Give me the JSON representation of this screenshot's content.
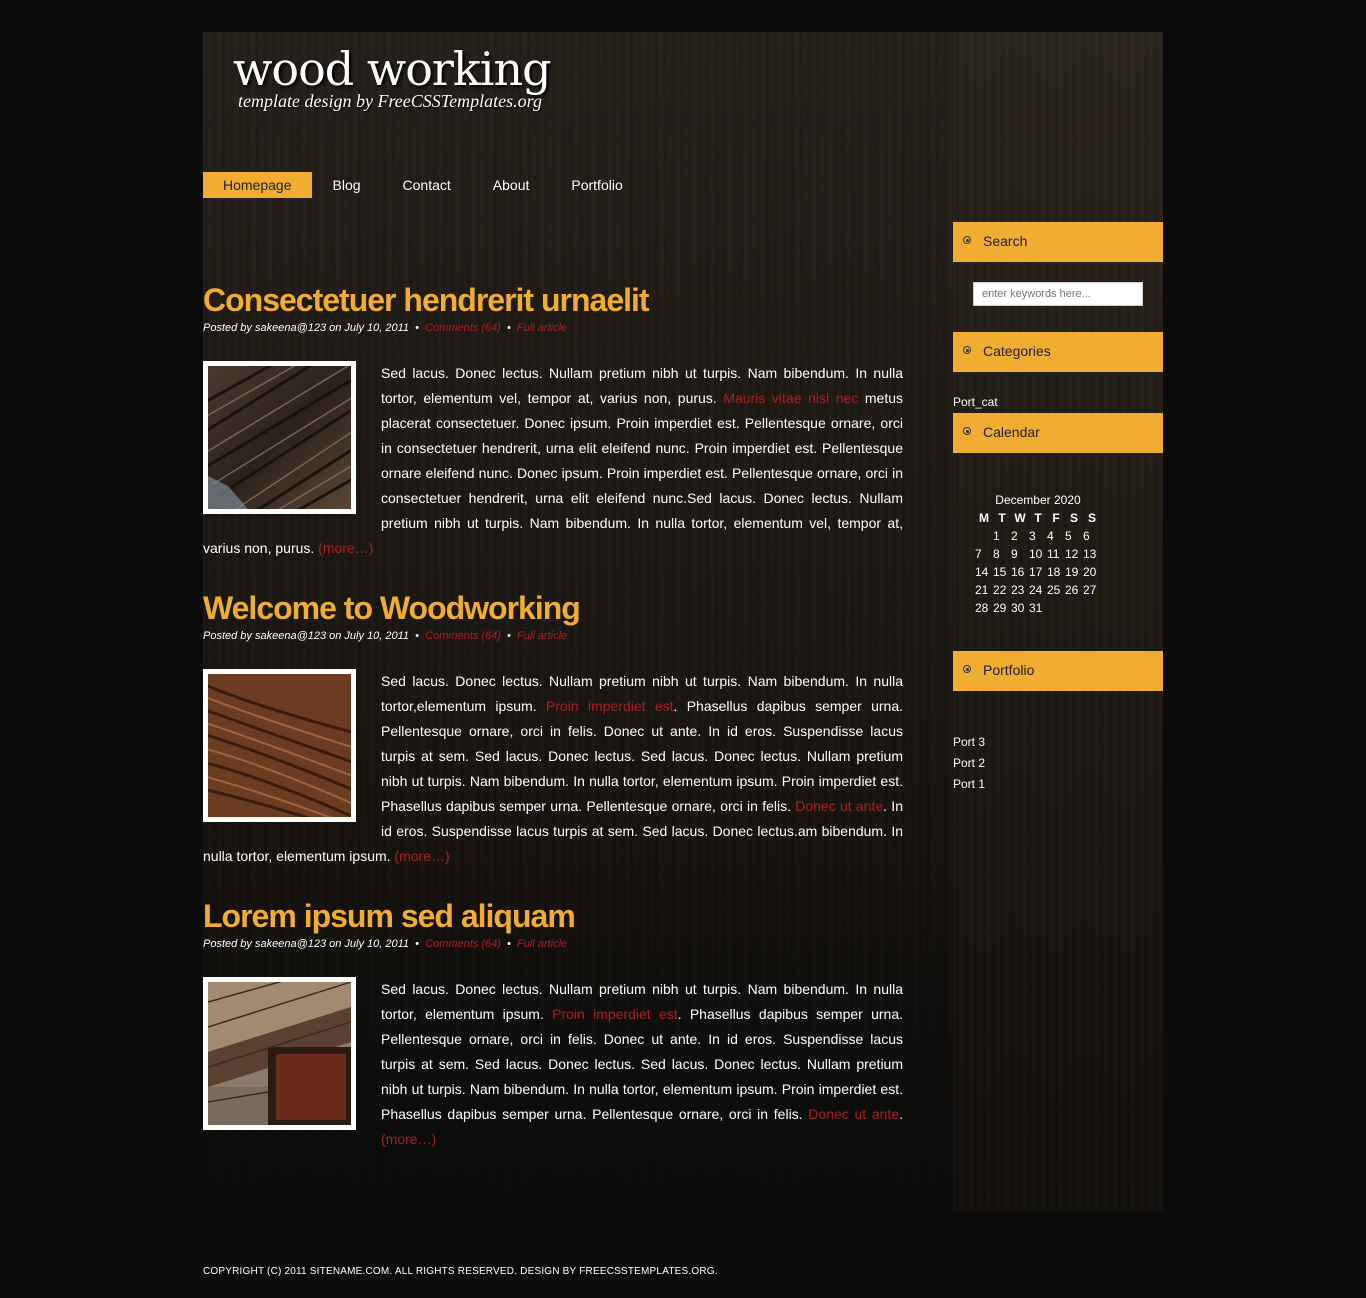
{
  "header": {
    "title": "wood working",
    "subtitle": "template design by FreeCSSTemplates.org"
  },
  "menu": [
    {
      "label": "Homepage",
      "active": true
    },
    {
      "label": "Blog"
    },
    {
      "label": "Contact"
    },
    {
      "label": "About"
    },
    {
      "label": "Portfolio"
    }
  ],
  "posts": [
    {
      "title": "Consectetuer hendrerit urnaelit",
      "byline": "Posted by sakeena@123 on July 10, 2011",
      "comments": "Comments (64)",
      "full": "Full article",
      "text1": "Sed lacus. Donec lectus. Nullam pretium nibh ut turpis. Nam bibendum. In nulla tortor, elementum vel, tempor at, varius non, purus. ",
      "link1": "Mauris vitae nisl nec",
      "text2": " metus placerat consectetuer. Donec ipsum. Proin imperdiet est. Pellentesque ornare, orci in consectetuer hendrerit, urna elit eleifend nunc. Proin imperdiet est. Pellentesque ornare eleifend nunc. Donec ipsum. Proin imperdiet est. Pellentesque ornare, orci in consectetuer hendrerit, urna elit eleifend nunc.Sed lacus. Donec lectus. Nullam pretium nibh ut turpis. Nam bibendum. In nulla tortor, elementum vel, tempor at, varius non, purus. ",
      "link2": "",
      "text3": "",
      "more": "(more…)"
    },
    {
      "title": "Welcome to Woodworking",
      "byline": "Posted by sakeena@123 on July 10, 2011",
      "comments": "Comments (64)",
      "full": "Full article",
      "text1": "Sed lacus. Donec lectus. Nullam pretium nibh ut turpis. Nam bibendum. In nulla tortor,elementum ipsum. ",
      "link1": "Proin imperdiet est",
      "text2": ". Phasellus dapibus semper urna. Pellentesque ornare, orci in felis. Donec ut ante. In id eros. Suspendisse lacus turpis at sem. Sed lacus. Donec lectus. Sed lacus. Donec lectus. Nullam pretium nibh ut turpis. Nam bibendum. In nulla tortor, elementum ipsum. Proin imperdiet est. Phasellus dapibus semper urna. Pellentesque ornare, orci in felis. ",
      "link2": "Donec ut ante",
      "text3": ". In id eros. Suspendisse lacus turpis at sem. Sed lacus. Donec lectus.am bibendum. In nulla tortor, elementum ipsum. ",
      "more": "(more…)"
    },
    {
      "title": "Lorem ipsum sed aliquam",
      "byline": "Posted by sakeena@123 on July 10, 2011",
      "comments": "Comments (64)",
      "full": "Full article",
      "text1": "Sed lacus. Donec lectus. Nullam pretium nibh ut turpis. Nam bibendum. In nulla tortor, elementum ipsum. ",
      "link1": "Proin imperdiet est",
      "text2": ". Phasellus dapibus semper urna. Pellentesque ornare, orci in felis. Donec ut ante. In id eros. Suspendisse lacus turpis at sem. Sed lacus. Donec lectus. Sed lacus. Donec lectus. Nullam pretium nibh ut turpis. Nam bibendum. In nulla tortor, elementum ipsum. Proin imperdiet est. Phasellus dapibus semper urna. Pellentesque ornare, orci in felis. ",
      "link2": "Donec ut ante",
      "text3": ". ",
      "more": "(more…)"
    }
  ],
  "sidebar": {
    "search_title": "Search",
    "search_placeholder": "enter keywords here...",
    "categories_title": "Categories",
    "categories": [
      "Port_cat"
    ],
    "calendar_title": "Calendar",
    "calendar": {
      "caption": "December 2020",
      "days": [
        "M",
        "T",
        "W",
        "T",
        "F",
        "S",
        "S"
      ],
      "weeks": [
        [
          "",
          "1",
          "2",
          "3",
          "4",
          "5",
          "6"
        ],
        [
          "7",
          "8",
          "9",
          "10",
          "11",
          "12",
          "13"
        ],
        [
          "14",
          "15",
          "16",
          "17",
          "18",
          "19",
          "20"
        ],
        [
          "21",
          "22",
          "23",
          "24",
          "25",
          "26",
          "27"
        ],
        [
          "28",
          "29",
          "30",
          "31",
          "",
          "",
          ""
        ]
      ]
    },
    "portfolio_title": "Portfolio",
    "portfolio": [
      "Port 3",
      "Port 2",
      "Port 1"
    ]
  },
  "footer": "COPYRIGHT (C) 2011 SITENAME.COM. ALL RIGHTS RESERVED. DESIGN BY FREECSSTEMPLATES.ORG.",
  "colors": {
    "accent": "#f0ad32",
    "link": "#a82020",
    "background": "#0b0b0b"
  }
}
